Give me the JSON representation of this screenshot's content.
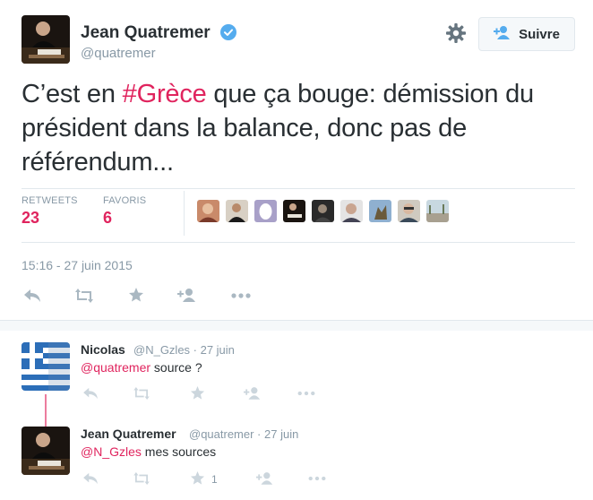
{
  "tweet": {
    "author_name": "Jean Quatremer",
    "author_handle": "@quatremer",
    "follow_label": "Suivre",
    "text_before": "C’est en ",
    "hashtag": "#Grèce",
    "text_after": " que ça bouge: démission du président dans la balance, donc pas de référendum...",
    "stats": {
      "retweets_label": "RETWEETS",
      "retweets_count": "23",
      "favorites_label": "FAVORIS",
      "favorites_count": "6"
    },
    "timestamp": "15:16 - 27 juin 2015",
    "favoriter_avatar_count": 9
  },
  "replies": [
    {
      "name": "Nicolas",
      "meta": "@N_Gzles · 27 juin",
      "mention": "@quatremer",
      "text": " source ?",
      "favorite_count": ""
    },
    {
      "name": "Jean Quatremer",
      "meta": "@quatremer · 27 juin",
      "mention": "@N_Gzles",
      "text": " mes sources",
      "favorite_count": "1"
    }
  ],
  "icons": {
    "verified": "verified-badge-icon",
    "settings": "gear-icon",
    "follow": "add-person-icon",
    "reply": "reply-icon",
    "retweet": "retweet-icon",
    "favorite": "star-icon",
    "follow_small": "add-person-icon",
    "more": "more-dots-icon"
  },
  "colors": {
    "accent": "#e0245e",
    "muted": "#8899a6",
    "text": "#292f33",
    "verified": "#55acee",
    "icon": "#aab8c2"
  }
}
